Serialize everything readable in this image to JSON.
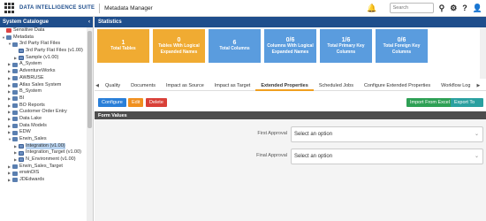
{
  "app": {
    "brand": "DATA INTELLIGENCE SUITE",
    "module": "Metadata Manager"
  },
  "topbar": {
    "search_placeholder": "Search",
    "bell": "🔔",
    "search_icon": "⚲",
    "settings_icon": "⚙",
    "help_icon": "?",
    "user_icon": "👤"
  },
  "sidebar": {
    "title": "System Catalogue",
    "collapse": "‹",
    "items": [
      {
        "label": "Sensitive Data",
        "indent": 0,
        "arrow": "",
        "icon": "lock"
      },
      {
        "label": "Metadata",
        "indent": 0,
        "arrow": "▼",
        "icon": "db"
      },
      {
        "label": "3rd Party Flat Files",
        "indent": 1,
        "arrow": "▼",
        "icon": "db"
      },
      {
        "label": "3rd Party Flat Files (v1.00)",
        "indent": 2,
        "arrow": "",
        "icon": "tbl"
      },
      {
        "label": "Sample (v1.00)",
        "indent": 2,
        "arrow": "▶",
        "icon": "tbl"
      },
      {
        "label": "A_System",
        "indent": 1,
        "arrow": "▶",
        "icon": "db"
      },
      {
        "label": "AdventureWorks",
        "indent": 1,
        "arrow": "▶",
        "icon": "db"
      },
      {
        "label": "AWBRUSE",
        "indent": 1,
        "arrow": "▶",
        "icon": "db"
      },
      {
        "label": "Atlas Sales System",
        "indent": 1,
        "arrow": "▶",
        "icon": "db"
      },
      {
        "label": "B_System",
        "indent": 1,
        "arrow": "▶",
        "icon": "db"
      },
      {
        "label": "BI",
        "indent": 1,
        "arrow": "▶",
        "icon": "db"
      },
      {
        "label": "BO Reports",
        "indent": 1,
        "arrow": "▶",
        "icon": "db"
      },
      {
        "label": "Customer Order Entry",
        "indent": 1,
        "arrow": "▶",
        "icon": "db"
      },
      {
        "label": "Data Lake",
        "indent": 1,
        "arrow": "▶",
        "icon": "db"
      },
      {
        "label": "Data Models",
        "indent": 1,
        "arrow": "▶",
        "icon": "db"
      },
      {
        "label": "EDW",
        "indent": 1,
        "arrow": "▶",
        "icon": "db"
      },
      {
        "label": "Erwin_Sales",
        "indent": 1,
        "arrow": "▼",
        "icon": "db"
      },
      {
        "label": "Integration (v1.00)",
        "indent": 2,
        "arrow": "▶",
        "icon": "tbl",
        "selected": true
      },
      {
        "label": "Integration_Target (v1.00)",
        "indent": 2,
        "arrow": "▶",
        "icon": "tbl"
      },
      {
        "label": "N_Environment (v1.00)",
        "indent": 2,
        "arrow": "▶",
        "icon": "tbl"
      },
      {
        "label": "Erwin_Sales_Target",
        "indent": 1,
        "arrow": "▶",
        "icon": "db"
      },
      {
        "label": "erwinDIS",
        "indent": 1,
        "arrow": "▶",
        "icon": "db"
      },
      {
        "label": "JDEdwards",
        "indent": 1,
        "arrow": "▶",
        "icon": "db"
      }
    ]
  },
  "main": {
    "title": "Statistics",
    "stats": [
      {
        "num": "1",
        "label": "Total Tables",
        "color": "orange"
      },
      {
        "num": "0",
        "label": "Tables With Logical Expanded Names",
        "color": "orange"
      },
      {
        "num": "6",
        "label": "Total Columns",
        "color": "blue"
      },
      {
        "num": "0/6",
        "label": "Columns With Logical Expanded Names",
        "color": "blue"
      },
      {
        "num": "1/6",
        "label": "Total Primary Key Columns",
        "color": "blue"
      },
      {
        "num": "0/6",
        "label": "Total Foreign Key Columns",
        "color": "blue"
      }
    ],
    "tabs": [
      "Quality",
      "Documents",
      "Impact as Source",
      "Impact as Target",
      "Extended Properties",
      "Scheduled Jobs",
      "Configure Extended Properties",
      "Workflow Log"
    ],
    "active_tab": "Extended Properties",
    "buttons": {
      "configure": "Configure",
      "edit": "Edit",
      "delete": "Delete",
      "import": "Import From Excel",
      "export": "Export To Excel"
    },
    "form": {
      "title": "Form Values",
      "fields": [
        {
          "label": "First Approval",
          "value": "Select an option"
        },
        {
          "label": "Final Approval",
          "value": "Select an option"
        }
      ]
    }
  },
  "colors": {
    "header": "#1f4e8c",
    "orange": "#f0ab32",
    "blue": "#5a9cde"
  }
}
